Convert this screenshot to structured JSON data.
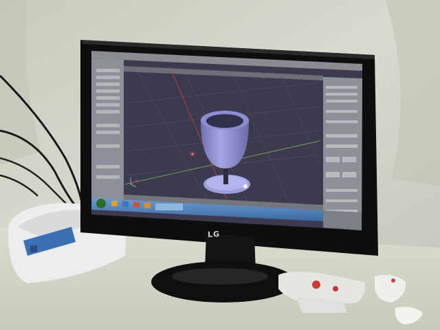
{
  "brand": {
    "monitor_logo": "LG"
  },
  "colors": {
    "wall": "#d6d7cc",
    "viewport_bg": "#3c3a4e",
    "model": "#8f8fd6",
    "taskbar": "#4d7fb6",
    "monitor_bezel": "#111111"
  },
  "icons": [
    "goblet-model-icon",
    "axis-gizmo-icon",
    "3d-cursor-icon"
  ]
}
